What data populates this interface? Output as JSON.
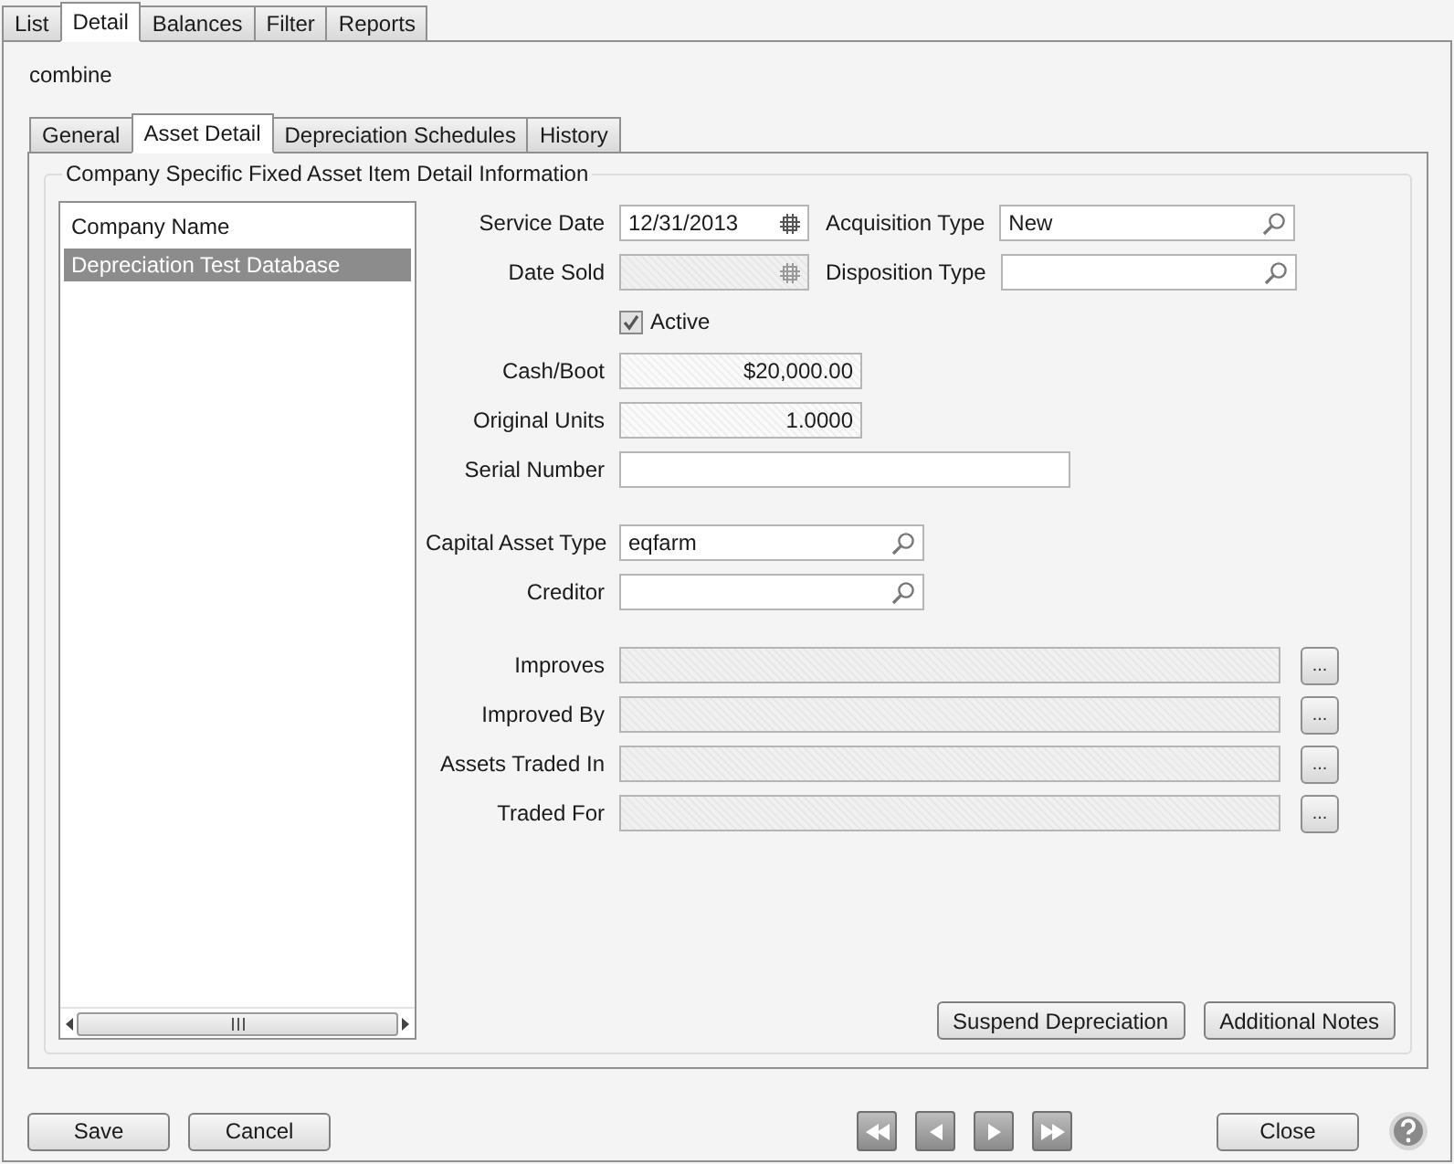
{
  "top_tabs": [
    {
      "label": "List",
      "selected": false
    },
    {
      "label": "Detail",
      "selected": true
    },
    {
      "label": "Balances",
      "selected": false
    },
    {
      "label": "Filter",
      "selected": false
    },
    {
      "label": "Reports",
      "selected": false
    }
  ],
  "record_name": "combine",
  "detail_tabs": [
    {
      "label": "General",
      "selected": false
    },
    {
      "label": "Asset Detail",
      "selected": true
    },
    {
      "label": "Depreciation Schedules",
      "selected": false
    },
    {
      "label": "History",
      "selected": false
    }
  ],
  "group_title": "Company Specific Fixed Asset Item Detail Information",
  "company_list": {
    "header": "Company Name",
    "rows": [
      {
        "name": "Depreciation Test Database",
        "selected": true
      }
    ]
  },
  "sections": [
    {
      "rows": [
        {
          "fields": [
            {
              "kind": "date",
              "label": "Service Date",
              "value": "12/31/2013",
              "disabled": false
            },
            {
              "kind": "lookup",
              "label": "Acquisition Type",
              "value": "New"
            }
          ]
        },
        {
          "fields": [
            {
              "kind": "date",
              "label": "Date Sold",
              "disabled": true
            },
            {
              "kind": "lookup",
              "label": "Disposition Type"
            }
          ]
        },
        {
          "fields": [
            {
              "kind": "checkbox",
              "label": "Active",
              "checked": true
            }
          ]
        },
        {
          "fields": [
            {
              "kind": "amount",
              "label": "Cash/Boot",
              "value": "$20,000.00"
            }
          ]
        },
        {
          "fields": [
            {
              "kind": "amount",
              "label": "Original Units",
              "value": "1.0000"
            }
          ]
        },
        {
          "fields": [
            {
              "kind": "text",
              "label": "Serial Number"
            }
          ]
        }
      ]
    },
    {
      "rows": [
        {
          "fields": [
            {
              "kind": "lookup",
              "label": "Capital Asset Type",
              "value": "eqfarm"
            }
          ]
        },
        {
          "fields": [
            {
              "kind": "lookup",
              "label": "Creditor"
            }
          ]
        }
      ]
    },
    {
      "rows": [
        {
          "fields": [
            {
              "kind": "linked",
              "label": "Improves",
              "button": "..."
            }
          ]
        },
        {
          "fields": [
            {
              "kind": "linked",
              "label": "Improved By",
              "button": "..."
            }
          ]
        },
        {
          "fields": [
            {
              "kind": "linked",
              "label": "Assets Traded In",
              "button": "..."
            }
          ]
        },
        {
          "fields": [
            {
              "kind": "linked",
              "label": "Traded For",
              "button": "..."
            }
          ]
        }
      ]
    }
  ],
  "action_buttons": [
    "Suspend Depreciation",
    "Additional Notes"
  ],
  "footer_buttons": [
    "Save",
    "Cancel"
  ],
  "close_button": "Close"
}
